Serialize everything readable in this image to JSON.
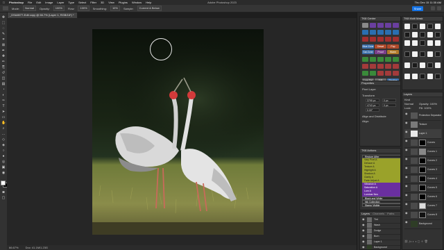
{
  "menubar": {
    "app": "Photoshop",
    "items": [
      "File",
      "Edit",
      "Image",
      "Layer",
      "Type",
      "Select",
      "Filter",
      "3D",
      "View",
      "Plugins",
      "Window",
      "Help"
    ],
    "window_title": "Adobe Photoshop 2023",
    "clock": "Thu Dec 15 11:35 AM"
  },
  "options": {
    "mode_label": "Mode:",
    "mode_value": "Normal",
    "opacity_label": "Opacity:",
    "opacity_value": "100%",
    "flow_label": "Flow:",
    "flow_value": "100%",
    "smoothing_label": "Smoothing:",
    "smoothing_value": "10%",
    "sample_label": "Sample:",
    "sample_value": "Current & Below",
    "share_label": "Share"
  },
  "document": {
    "tab_title": "_DSA8077-Edit copy @ 66.7% (Layer 1, RGB/16*) *",
    "zoom": "66.67%",
    "doc_info": "Doc: 41.1M/1.23G"
  },
  "panels": {
    "tk8_centre": "TK8 Centre",
    "tk8_multi_mask": "TK8 Multi Mask",
    "properties": "Properties",
    "pixel_layer": "Pixel Layer",
    "transform": "Transform",
    "w_value": "3795 px",
    "h_value": "4743 px",
    "x_value": "0 px",
    "y_value": "0 px",
    "angle": "0.00°",
    "align_distribute": "Align and Distribute",
    "align": "Align:",
    "tk8_actions": "TK8 Actions",
    "layers": "Layers",
    "channels": "Channels",
    "paths": "Paths",
    "layers_right": "Layers",
    "kind": "Kind",
    "normal": "Normal",
    "opacity": "Opacity: 100%",
    "fill": "Fill: 100%",
    "lock": "Lock:",
    "tk8_centre_buttons": [
      "Blue Zone",
      "Desat",
      "Pop",
      "Sat Zone",
      "Proof",
      "Warm",
      "Lum Sel",
      "D/B",
      "Finalise"
    ],
    "actions": [
      {
        "label": "Restore After",
        "color": "#2a2a2a"
      },
      {
        "label": "Vary Pixel A",
        "color": "#9aa22a"
      },
      {
        "label": "Dehaze A",
        "color": "#9aa22a"
      },
      {
        "label": "Texture A",
        "color": "#9aa22a"
      },
      {
        "label": "Highlight A",
        "color": "#9aa22a"
      },
      {
        "label": "Shadow A",
        "color": "#9aa22a"
      },
      {
        "label": "Clarity A",
        "color": "#9aa22a"
      },
      {
        "label": "Fade Adjust A",
        "color": "#9aa22a"
      },
      {
        "label": "Vibrance A",
        "color": "#6a2fa0"
      },
      {
        "label": "Saturation A",
        "color": "#6a2fa0"
      },
      {
        "label": "Lum A",
        "color": "#6a2fa0"
      },
      {
        "label": "Luminar Neo",
        "color": "#6a2fa0"
      },
      {
        "label": "Black and White",
        "color": "#2a2a2a"
      },
      {
        "label": "Nik Collection",
        "color": "#2a2a2a"
      },
      {
        "label": "Stamp Visible",
        "color": "#2a2a2a"
      }
    ],
    "left_layers": [
      "Tint",
      "Wash",
      "Dodge",
      "Burn",
      "Layer 1",
      "Background"
    ],
    "right_layers": [
      "Protection Separator",
      "Texture",
      "Layer 1",
      "Curves",
      "Curves 1",
      "Curves 2",
      "Curves 3",
      "Curves 4",
      "Curves 5",
      "Curves 6",
      "Curves 7",
      "Curves 8",
      "Background"
    ]
  },
  "colors": {
    "accent": "#1473e6",
    "olive_action": "#9aa22a",
    "purple_action": "#6a2fa0"
  }
}
